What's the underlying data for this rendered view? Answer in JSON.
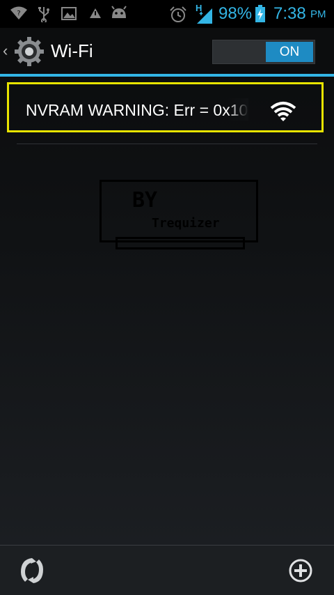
{
  "status_bar": {
    "battery_percent": "98%",
    "time": "7:38",
    "ampm": "PM",
    "network_type": "H",
    "icons": [
      "wifi-question-icon",
      "usb-icon",
      "image-icon",
      "notification-icon",
      "android-icon",
      "alarm-icon",
      "signal-icon",
      "battery-charging-icon"
    ],
    "accent_color": "#33b5e5"
  },
  "action_bar": {
    "title": "Wi-Fi",
    "toggle_label": "ON",
    "toggle_state": true
  },
  "networks": [
    {
      "name": "NVRAM WARNING: Err = 0x10",
      "signal": "full"
    }
  ],
  "watermark": {
    "line1": "BY",
    "line2": "Trequizer"
  },
  "bottom_bar": {
    "left_icon": "scan-refresh-icon",
    "right_icon": "add-network-icon"
  },
  "colors": {
    "highlight": "#e8e400",
    "toggle_on": "#1e8bc3"
  }
}
